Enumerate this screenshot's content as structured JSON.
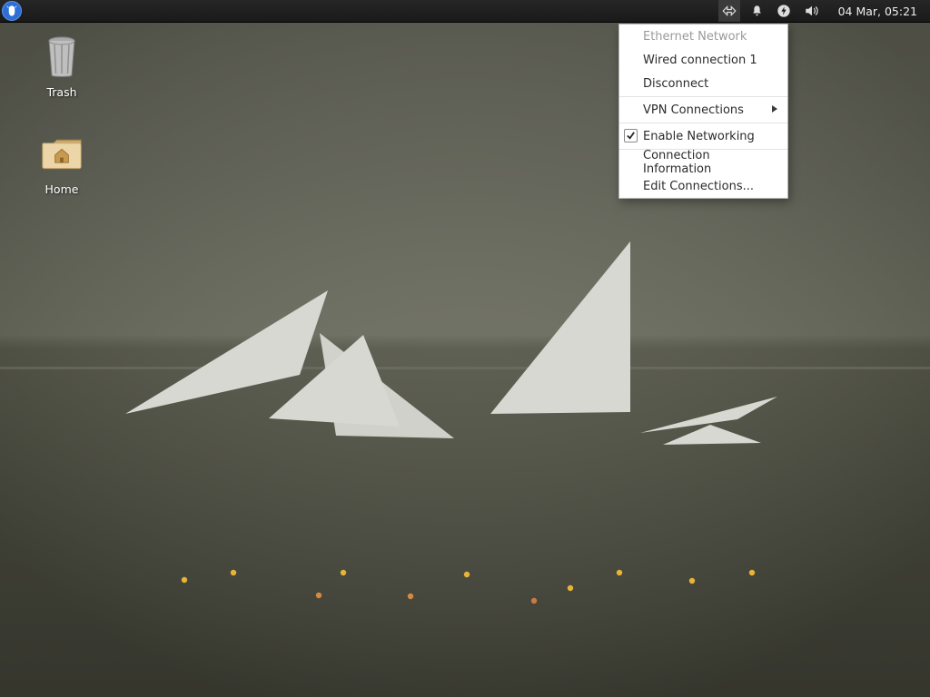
{
  "panel": {
    "clock": "04 Mar, 05:21",
    "tray": {
      "network_title": "Network",
      "notifications_title": "Notifications",
      "power_title": "Power",
      "volume_title": "Volume"
    }
  },
  "desktop": {
    "icons": [
      {
        "id": "trash",
        "label": "Trash"
      },
      {
        "id": "home",
        "label": "Home"
      }
    ]
  },
  "network_menu": {
    "section_header": "Ethernet Network",
    "items": {
      "wired": "Wired connection 1",
      "disconnect": "Disconnect",
      "vpn": "VPN Connections",
      "enable": "Enable Networking",
      "info": "Connection Information",
      "edit": "Edit Connections..."
    },
    "enable_checked": true
  }
}
